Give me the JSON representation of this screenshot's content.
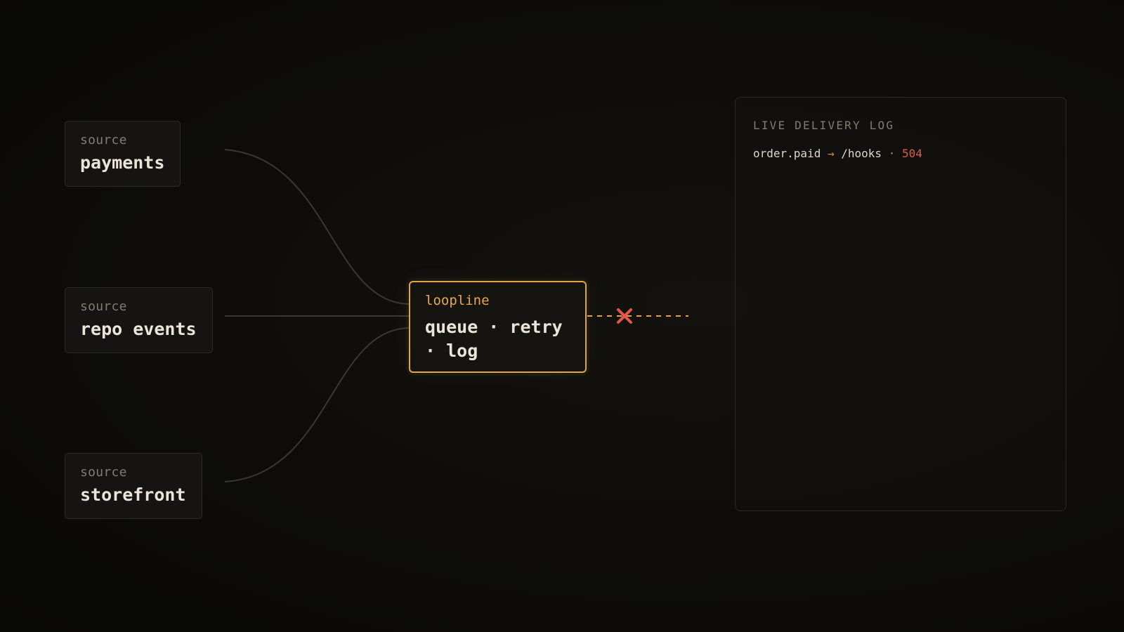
{
  "sources": [
    {
      "kicker": "source",
      "name": "payments"
    },
    {
      "kicker": "source",
      "name": "repo events"
    },
    {
      "kicker": "source",
      "name": "storefront"
    }
  ],
  "hub": {
    "name": "loopline",
    "description": "queue · retry · log"
  },
  "delivery": {
    "status": "failed",
    "marker_icon": "x-mark-icon"
  },
  "log_panel": {
    "title": "LIVE DELIVERY LOG",
    "entries": [
      {
        "event": "order.paid",
        "arrow": "→",
        "endpoint": "/hooks",
        "separator": "·",
        "status": "504"
      }
    ]
  },
  "colors": {
    "background": "#0c0b0a",
    "accent": "#e0a548",
    "error": "#e2574c",
    "arrow": "#d98a2f",
    "muted_text": "#847b70",
    "text": "#ebe4d8"
  }
}
